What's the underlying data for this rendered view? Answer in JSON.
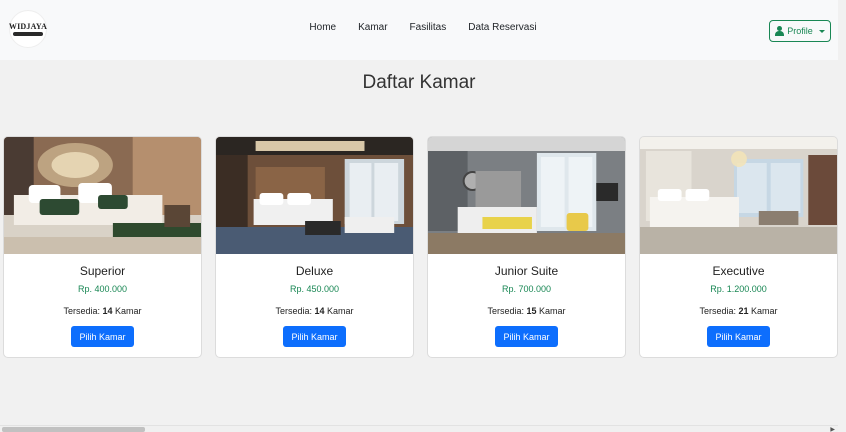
{
  "nav": {
    "logo_text": "WIDJAYA",
    "links": [
      "Home",
      "Kamar",
      "Fasilitas",
      "Data Reservasi"
    ],
    "profile_label": "Profile"
  },
  "page_title": "Daftar Kamar",
  "rooms": [
    {
      "name": "Superior",
      "price": "Rp. 400.000",
      "stock_label": "Tersedia:",
      "stock": "14",
      "stock_unit": "Kamar",
      "button": "Pilih Kamar"
    },
    {
      "name": "Deluxe",
      "price": "Rp. 450.000",
      "stock_label": "Tersedia:",
      "stock": "14",
      "stock_unit": "Kamar",
      "button": "Pilih Kamar"
    },
    {
      "name": "Junior Suite",
      "price": "Rp. 700.000",
      "stock_label": "Tersedia:",
      "stock": "15",
      "stock_unit": "Kamar",
      "button": "Pilih Kamar"
    },
    {
      "name": "Executive",
      "price": "Rp. 1.200.000",
      "stock_label": "Tersedia:",
      "stock": "21",
      "stock_unit": "Kamar",
      "button": "Pilih Kamar"
    }
  ],
  "colors": {
    "nav_bg": "#f8f9fa",
    "page_bg": "#f1f1f1",
    "primary": "#0d6efd",
    "success": "#198754"
  },
  "icons": {
    "profile": "person-icon",
    "dropdown": "caret-down-icon"
  }
}
